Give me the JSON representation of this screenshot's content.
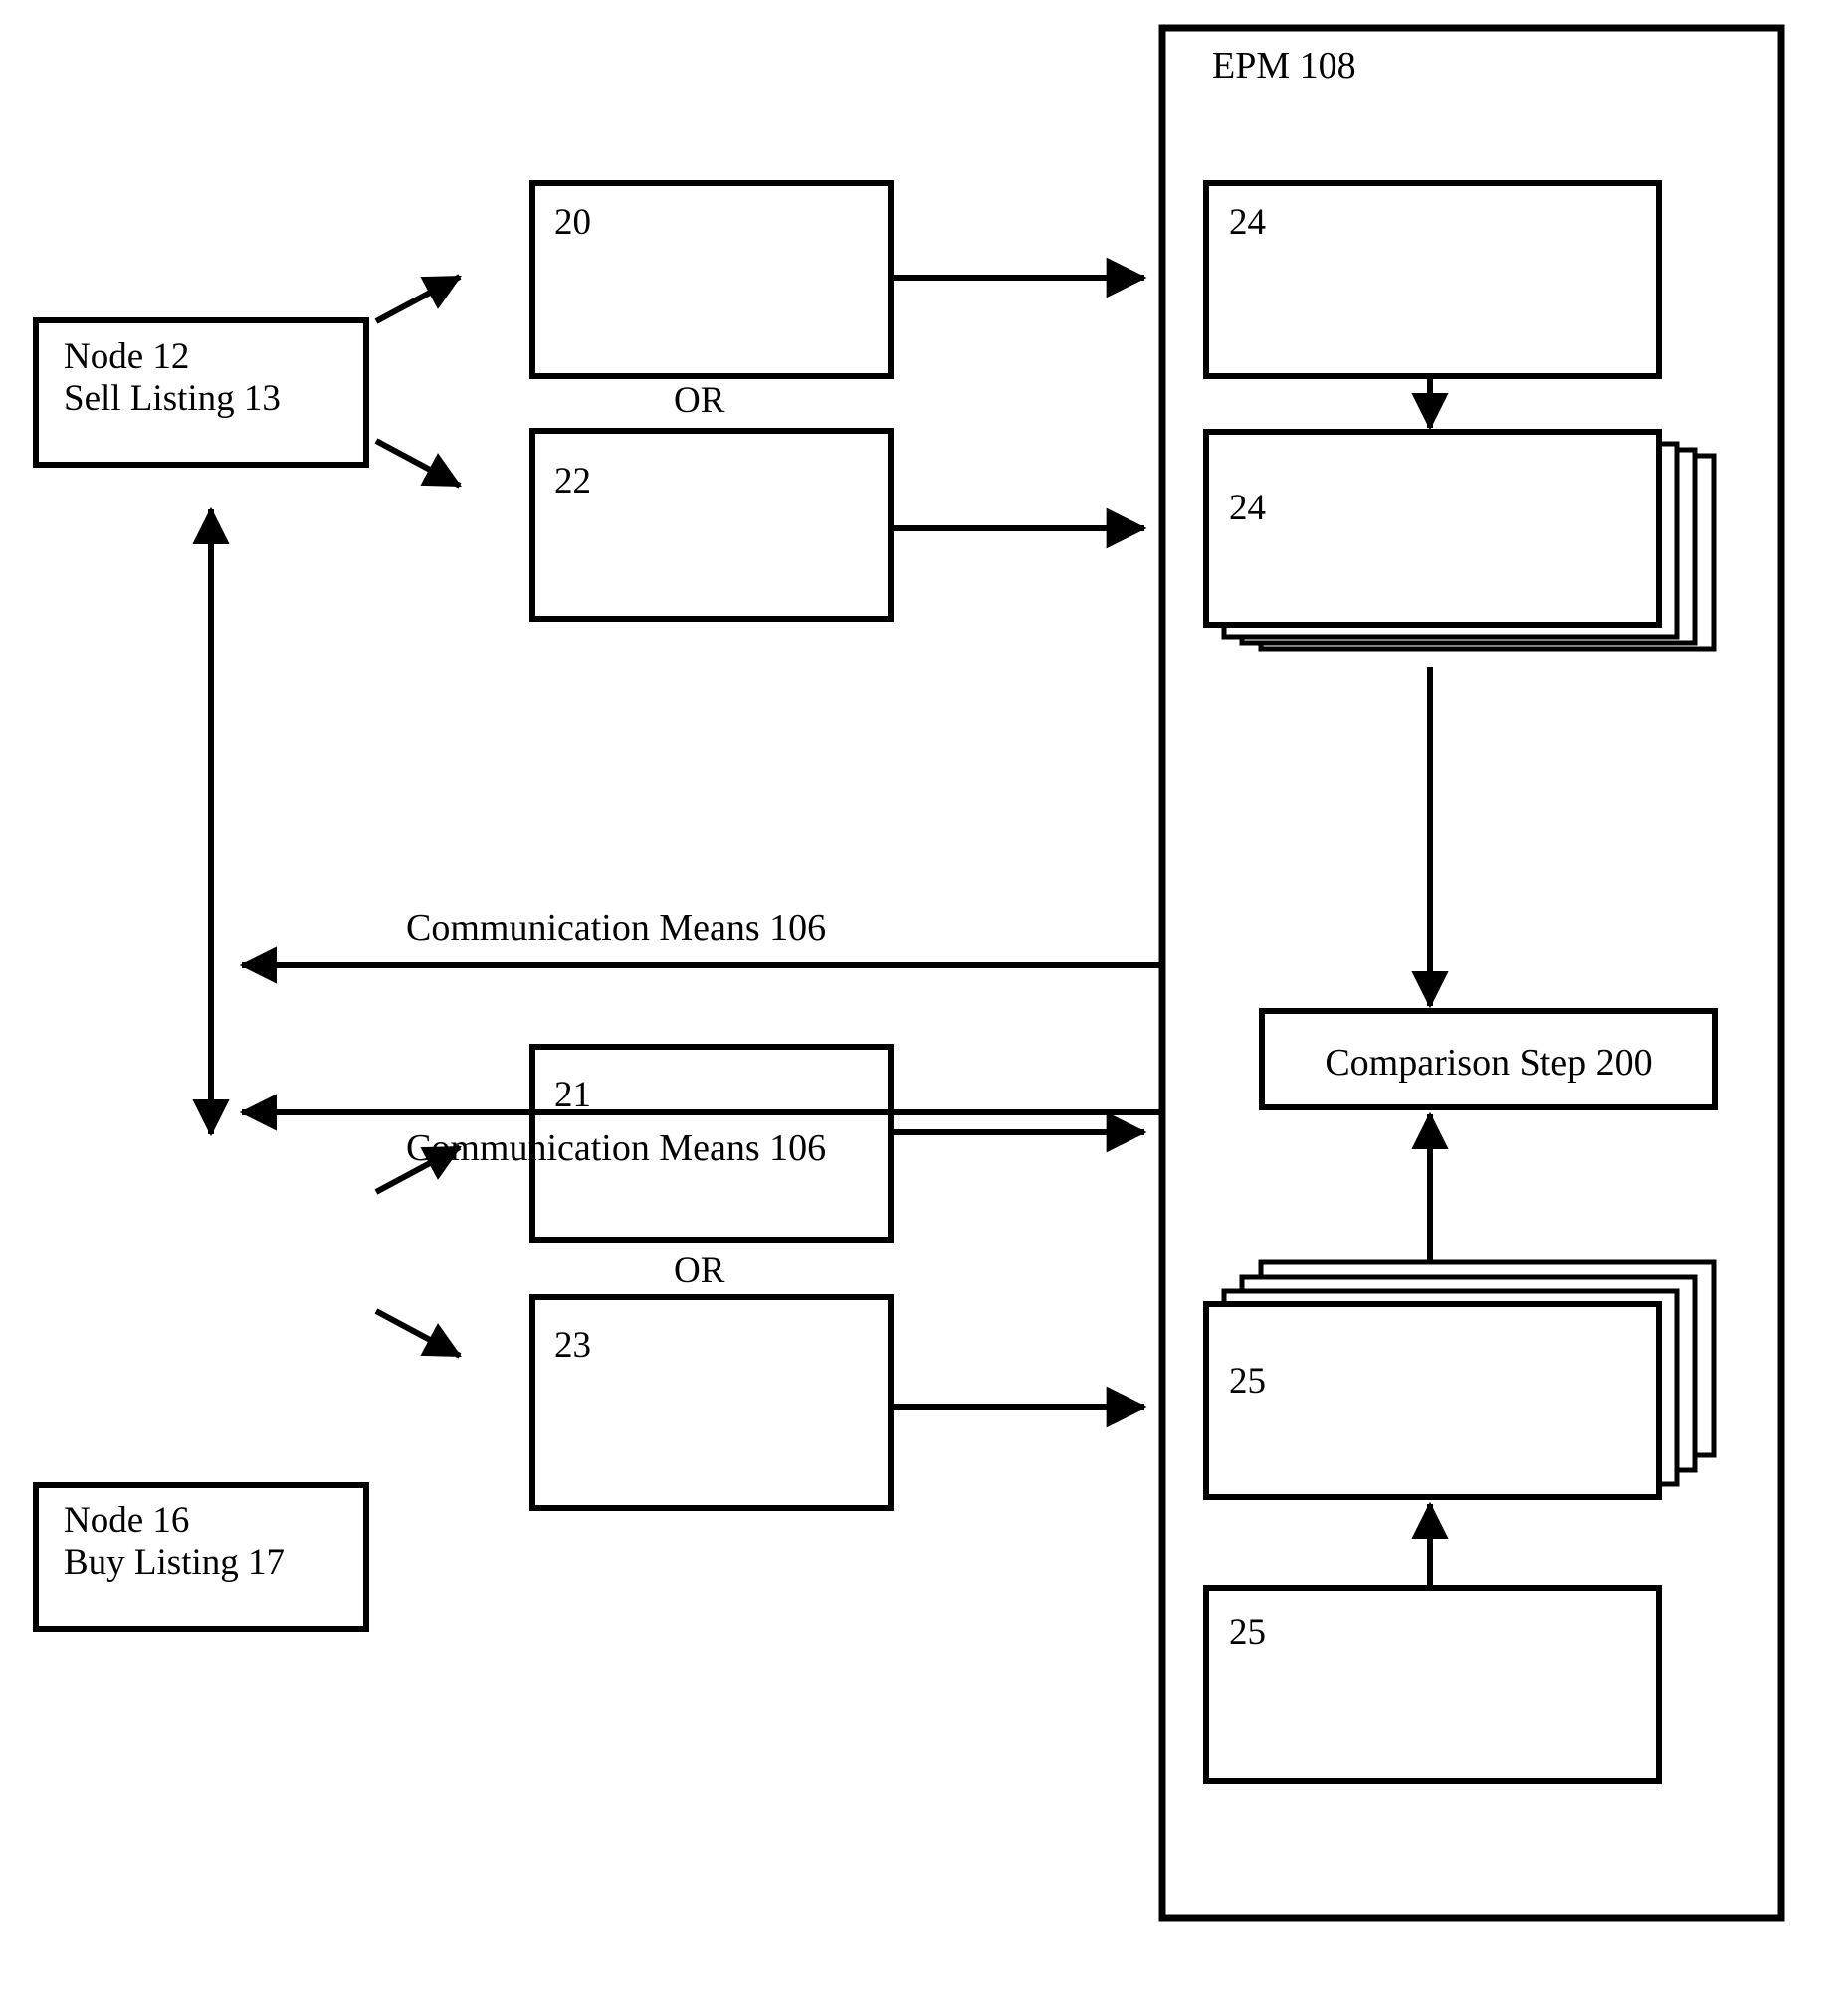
{
  "diagram": {
    "title_label": "EPM 108",
    "outer_container": {
      "label": "EPM 108"
    },
    "nodes": {
      "sell": {
        "line1": "Node 12",
        "line2": "Sell Listing 13"
      },
      "buy": {
        "line1": "Node 16",
        "line2": "Buy Listing 17"
      }
    },
    "boxes": {
      "b20": "20",
      "b22": "22",
      "b21": "21",
      "b23": "23",
      "b24_top": "24",
      "b24_stack": "24",
      "b25_stack": "25",
      "b25_bottom": "25"
    },
    "or_labels": {
      "upper": "OR",
      "lower": "OR"
    },
    "comparison": {
      "label": "Comparison Step 200"
    },
    "communication": {
      "upper": "Communication Means 106",
      "lower": "Communication Means 106"
    },
    "colors": {
      "line": "#000000",
      "fill": "#ffffff",
      "background": "#ffffff"
    }
  }
}
